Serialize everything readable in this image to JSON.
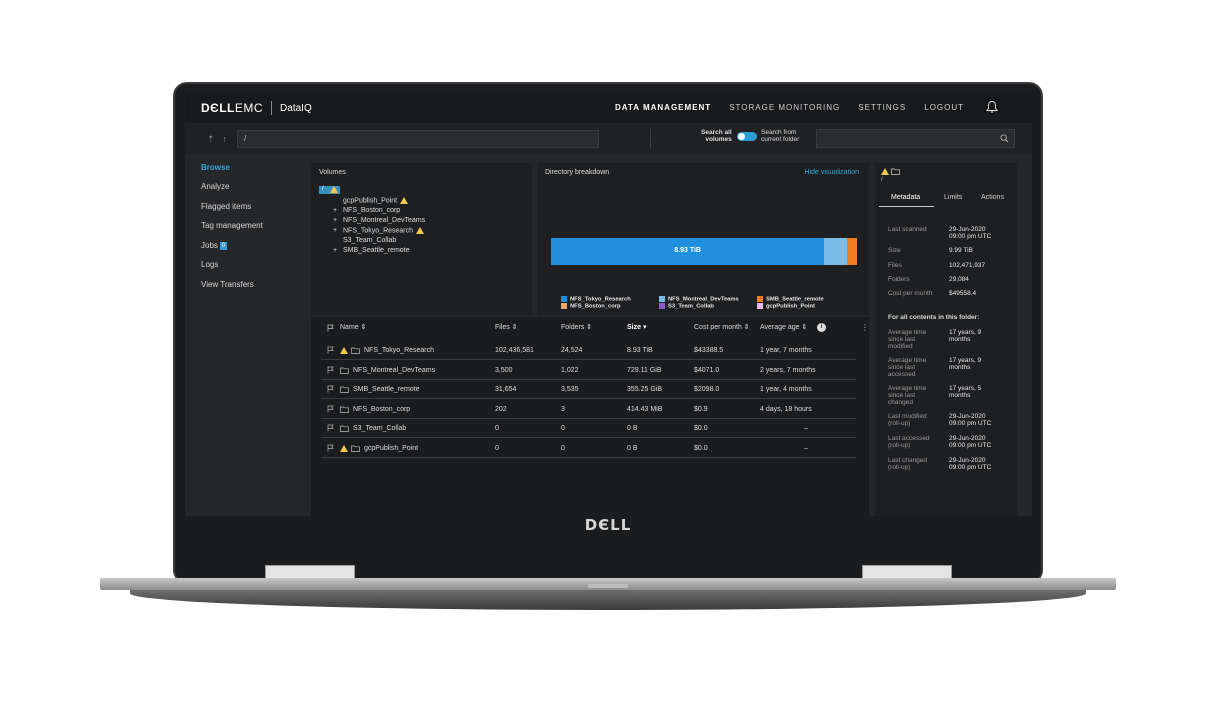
{
  "header": {
    "brand": "DЄLLEMC",
    "brand_dell": "DЄLL",
    "brand_emc": "EMC",
    "app_name": "DataIQ",
    "nav": [
      "DATA MANAGEMENT",
      "STORAGE MONITORING",
      "SETTINGS",
      "LOGOUT"
    ],
    "bell_icon": "bell-icon"
  },
  "pathbar": {
    "path": "/",
    "search_all": "Search all\nvolumes",
    "search_all_l1": "Search all",
    "search_all_l2": "volumes",
    "search_from_l1": "Search from",
    "search_from_l2": "current folder",
    "search_placeholder": ""
  },
  "sidebar": {
    "items": [
      "Browse",
      "Analyze",
      "Flagged items",
      "Tag management",
      "Jobs",
      "Logs",
      "View Transfers"
    ],
    "jobs_badge": "0"
  },
  "volumes": {
    "title": "Volumes",
    "root_label": "/",
    "items": [
      {
        "prefix": "",
        "name": "gcpPublish_Point",
        "warn": true
      },
      {
        "prefix": "+",
        "name": "NFS_Boston_corp",
        "warn": false
      },
      {
        "prefix": "+",
        "name": "NFS_Montreal_DevTeams",
        "warn": false
      },
      {
        "prefix": "+",
        "name": "NFS_Tokyo_Research",
        "warn": true
      },
      {
        "prefix": "",
        "name": "S3_Team_Collab",
        "warn": false
      },
      {
        "prefix": "+",
        "name": "SMB_Seattle_remote",
        "warn": false
      }
    ]
  },
  "directory": {
    "title": "Directory breakdown",
    "hide_label": "Hide visualization",
    "bar_label": "8.93 TiB",
    "segments": [
      {
        "name": "NFS_Tokyo_Research",
        "fraction": 0.893,
        "color": "#1f8fde"
      },
      {
        "name": "NFS_Montreal_DevTeams",
        "fraction": 0.073,
        "color": "#7bbbe8"
      },
      {
        "name": "SMB_Seattle_remote",
        "fraction": 0.034,
        "color": "#f07d1e"
      },
      {
        "name": "NFS_Boston_corp",
        "fraction": 0.0,
        "color": "#f0a868"
      },
      {
        "name": "S3_Team_Collab",
        "fraction": 0.0,
        "color": "#8e5cc9"
      },
      {
        "name": "gcpPublish_Point",
        "fraction": 0.0,
        "color": "#e7b8e8"
      }
    ]
  },
  "table": {
    "columns": [
      "Name",
      "Files",
      "Folders",
      "Size",
      "Cost per month",
      "Average age"
    ],
    "rows": [
      {
        "name": "NFS_Tokyo_Research",
        "warn": true,
        "files": "102,436,581",
        "folders": "24,524",
        "size": "8.93 TiB",
        "cost": "$43388.5",
        "age": "1 year, 7 months"
      },
      {
        "name": "NFS_Montreal_DevTeams",
        "warn": false,
        "files": "3,500",
        "folders": "1,022",
        "size": "729.11 GiB",
        "cost": "$4071.0",
        "age": "2 years, 7 months"
      },
      {
        "name": "SMB_Seattle_remote",
        "warn": false,
        "files": "31,654",
        "folders": "3,535",
        "size": "355.25 GiB",
        "cost": "$2098.0",
        "age": "1 year, 4 months"
      },
      {
        "name": "NFS_Boston_corp",
        "warn": false,
        "files": "202",
        "folders": "3",
        "size": "414.43 MiB",
        "cost": "$0.9",
        "age": "4 days, 18 hours"
      },
      {
        "name": "S3_Team_Collab",
        "warn": false,
        "files": "0",
        "folders": "0",
        "size": "0 B",
        "cost": "$0.0",
        "age": "–"
      },
      {
        "name": "gcpPublish_Point",
        "warn": true,
        "files": "0",
        "folders": "0",
        "size": "0 B",
        "cost": "$0.0",
        "age": "–"
      }
    ]
  },
  "metadata": {
    "path": "/",
    "tabs": [
      "Metadata",
      "Limits",
      "Actions"
    ],
    "fields": [
      {
        "k": "Last scanned",
        "v": "29-Jun-2020\n09:00 pm UTC"
      },
      {
        "k": "Size",
        "v": "9.99 TiB"
      },
      {
        "k": "Files",
        "v": "102,471,937"
      },
      {
        "k": "Folders",
        "v": "29,084"
      },
      {
        "k": "Cost per month",
        "v": "$49558.4"
      }
    ],
    "section_title": "For all contents in this folder:",
    "rollup": [
      {
        "k": "Average time\nsince last\nmodified",
        "v": "17 years, 9\nmonths"
      },
      {
        "k": "Average time\nsince last\naccessed",
        "v": "17 years, 9\nmonths"
      },
      {
        "k": "Average time\nsince last\nchanged",
        "v": "17 years, 5\nmonths"
      },
      {
        "k": "Last modified\n(roll-up)",
        "v": "29-Jun-2020\n09:00 pm UTC"
      },
      {
        "k": "Last accessed\n(roll-up)",
        "v": "29-Jun-2020\n09:00 pm UTC"
      },
      {
        "k": "Last changed\n(roll-up)",
        "v": "29-Jun-2020\n09:00 pm UTC"
      }
    ]
  },
  "device": {
    "bezel_logo": "DЄLL"
  }
}
